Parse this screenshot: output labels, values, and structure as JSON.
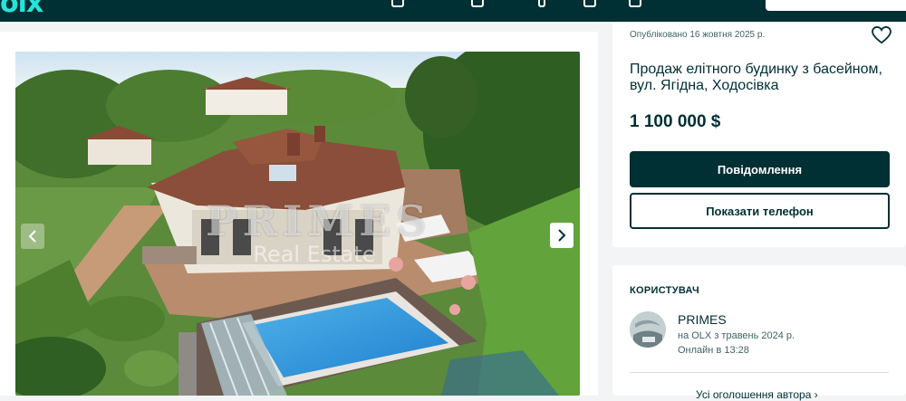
{
  "header": {
    "logo_text": "olx",
    "logo_color": "#23e5db",
    "background": "#002f34",
    "icons": [
      "chat-icon",
      "heart-icon",
      "bell-icon",
      "user-icon"
    ]
  },
  "gallery": {
    "photo_description_icon": "photo",
    "watermark_line1": "PRIMES",
    "watermark_line2": "Real Estate",
    "prev_icon": "chevron-left-icon",
    "next_icon": "chevron-right-icon"
  },
  "listing": {
    "published": "Опубліковано 16 жовтня 2025 р.",
    "title": "Продаж елітного будинку з басейном, вул. Ягідна, Ходосівка",
    "price": "1 100 000 $",
    "message_button": "Повідомлення",
    "phone_button": "Показати телефон"
  },
  "user": {
    "heading": "КОРИСТУВАЧ",
    "name": "PRIMES",
    "since": "на OLX з травень 2024 р.",
    "online": "Онлайн в 13:28",
    "all_ads_link": "Усі оголошення автора"
  },
  "colors": {
    "primary": "#002f34",
    "muted": "#406367",
    "page_bg": "#f2f4f5"
  }
}
